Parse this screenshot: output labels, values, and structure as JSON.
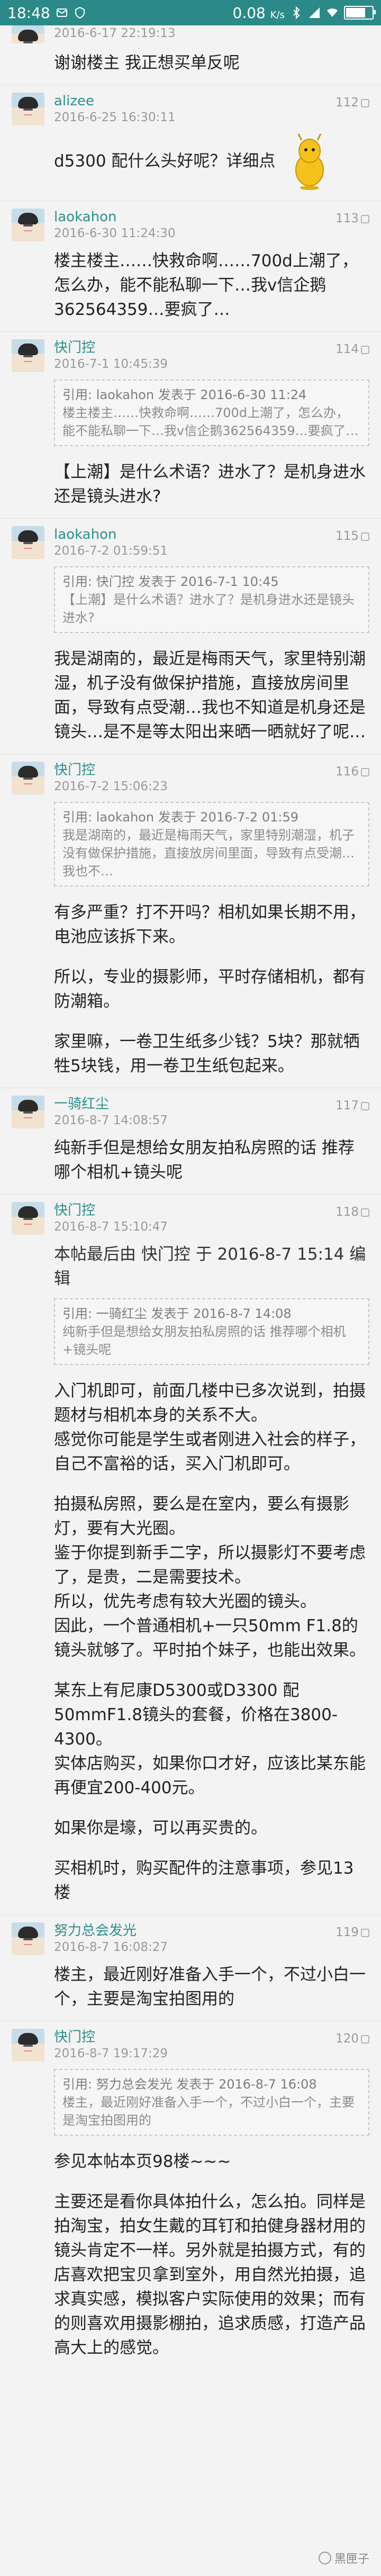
{
  "status_bar": {
    "time": "18:48",
    "net_speed": "0.08",
    "net_unit": "K/s",
    "battery_text": ""
  },
  "posts": [
    {
      "time": "2016-6-17 22:19:13",
      "content": [
        "谢谢楼主 我正想买单反呢"
      ]
    },
    {
      "username": "alizee",
      "time": "2016-6-25 16:30:11",
      "floor": "112",
      "content": [
        "d5300 配什么头好呢？详细点"
      ]
    },
    {
      "username": "laokahon",
      "time": "2016-6-30 11:24:30",
      "floor": "113",
      "content": [
        "楼主楼主……快救命啊……700d上潮了，怎么办，能不能私聊一下…我v信企鹅362564359…要疯了…"
      ]
    },
    {
      "username": "快门控",
      "time": "2016-7-1 10:45:39",
      "floor": "114",
      "quote": {
        "head": "引用: laokahon 发表于 2016-6-30 11:24",
        "body": "楼主楼主……快救命啊……700d上潮了，怎么办，能不能私聊一下…我v信企鹅362564359…要疯了…"
      },
      "content": [
        "【上潮】是什么术语？进水了？是机身进水还是镜头进水?"
      ]
    },
    {
      "username": "laokahon",
      "time": "2016-7-2 01:59:51",
      "floor": "115",
      "quote": {
        "head": "引用: 快门控 发表于 2016-7-1 10:45",
        "body": "【上潮】是什么术语？进水了？是机身进水还是镜头进水?"
      },
      "content": [
        "我是湖南的，最近是梅雨天气，家里特别潮湿，机子没有做保护措施，直接放房间里面，导致有点受潮…我也不知道是机身还是镜头…是不是等太阳出来晒一晒就好了呢…"
      ]
    },
    {
      "username": "快门控",
      "time": "2016-7-2 15:06:23",
      "floor": "116",
      "quote": {
        "head": "引用: laokahon 发表于 2016-7-2 01:59",
        "body": "我是湖南的，最近是梅雨天气，家里特别潮湿，机子没有做保护措施，直接放房间里面，导致有点受潮…我也不…"
      },
      "content": [
        "有多严重？打不开吗？相机如果长期不用，电池应该拆下来。",
        "所以，专业的摄影师，平时存储相机，都有防潮箱。",
        "家里嘛，一卷卫生纸多少钱？5块？那就牺牲5块钱，用一卷卫生纸包起来。"
      ]
    },
    {
      "username": "一骑红尘",
      "time": "2016-8-7 14:08:57",
      "floor": "117",
      "content": [
        "纯新手但是想给女朋友拍私房照的话 推荐哪个相机+镜头呢"
      ]
    },
    {
      "username": "快门控",
      "time": "2016-8-7 15:10:47",
      "floor": "118",
      "edit_note": "本帖最后由 快门控 于 2016-8-7 15:14 编辑",
      "quote": {
        "head": "引用: 一骑红尘 发表于 2016-8-7 14:08",
        "body": "纯新手但是想给女朋友拍私房照的话 推荐哪个相机+镜头呢"
      },
      "content": [
        "入门机即可，前面几楼中已多次说到，拍摄题材与相机本身的关系不大。\n感觉你可能是学生或者刚进入社会的样子，自己不富裕的话，买入门机即可。",
        "拍摄私房照，要么是在室内，要么有摄影灯，要有大光圈。\n鉴于你提到新手二字，所以摄影灯不要考虑了，是贵，二是需要技术。\n所以，优先考虑有较大光圈的镜头。\n因此，一个普通相机+一只50mm F1.8的镜头就够了。平时拍个妹子，也能出效果。",
        "某东上有尼康D5300或D3300 配50mmF1.8镜头的套餐，价格在3800-4300。\n实体店购买，如果你口才好，应该比某东能再便宜200-400元。",
        "如果你是壕，可以再买贵的。",
        "买相机时，购买配件的注意事项，参见13楼"
      ]
    },
    {
      "username": "努力总会发光",
      "time": "2016-8-7 16:08:27",
      "floor": "119",
      "content": [
        "楼主，最近刚好准备入手一个，不过小白一个，主要是淘宝拍图用的"
      ]
    },
    {
      "username": "快门控",
      "time": "2016-8-7 19:17:29",
      "floor": "120",
      "quote": {
        "head": "引用: 努力总会发光 发表于 2016-8-7 16:08",
        "body": "楼主，最近刚好准备入手一个，不过小白一个，主要是淘宝拍图用的"
      },
      "content": [
        "参见本帖本页98楼~~~",
        "主要还是看你具体拍什么，怎么拍。同样是拍淘宝，拍女生戴的耳钉和拍健身器材用的镜头肯定不一样。另外就是拍摄方式，有的店喜欢把宝贝拿到室外，用自然光拍摄，追求真实感，模拟客户实际使用的效果；而有的则喜欢用摄影棚拍，追求质感，打造产品高大上的感觉。"
      ]
    }
  ],
  "watermark": "黑匣子"
}
